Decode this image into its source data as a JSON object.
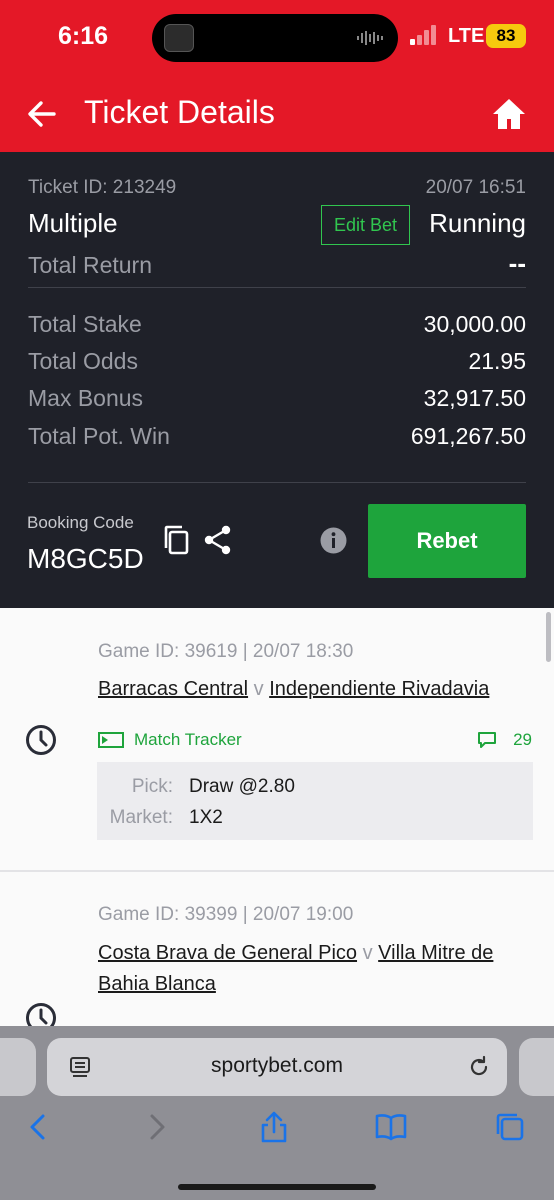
{
  "status_bar": {
    "time": "6:16",
    "network": "LTE",
    "battery": "83"
  },
  "header": {
    "title": "Ticket Details"
  },
  "ticket": {
    "id_label": "Ticket ID: 213249",
    "datetime": "20/07 16:51",
    "type": "Multiple",
    "edit_label": "Edit Bet",
    "status": "Running",
    "total_return_label": "Total Return",
    "total_return_value": "--",
    "rows": [
      {
        "label": "Total Stake",
        "value": "30,000.00"
      },
      {
        "label": "Total Odds",
        "value": "21.95"
      },
      {
        "label": "Max Bonus",
        "value": "32,917.50"
      },
      {
        "label": "Total Pot. Win",
        "value": "691,267.50"
      }
    ],
    "booking_label": "Booking Code",
    "booking_code": "M8GC5D",
    "rebet_label": "Rebet"
  },
  "games": [
    {
      "game_id": "Game ID: 39619 | 20/07 18:30",
      "home": "Barracas Central",
      "vs": "v",
      "away": "Independiente Rivadavia",
      "tracker_label": "Match Tracker",
      "comments": "29",
      "pick_label": "Pick:",
      "pick_value": "Draw @2.80",
      "market_label": "Market:",
      "market_value": "1X2"
    },
    {
      "game_id": "Game ID: 39399 | 20/07 19:00",
      "home": "Costa Brava de General Pico",
      "vs": "v",
      "away": "Villa Mitre de Bahia Blanca"
    }
  ],
  "browser": {
    "url": "sportybet.com"
  },
  "colors": {
    "brand_red": "#e41827",
    "panel_dark": "#1f2129",
    "green": "#1ea43c"
  },
  "icons": [
    "back-arrow-icon",
    "home-icon",
    "copy-icon",
    "share-icon",
    "info-icon",
    "clock-icon",
    "match-tracker-icon",
    "comment-icon",
    "reader-icon",
    "reload-icon",
    "back-icon",
    "forward-icon",
    "share-icon",
    "bookmarks-icon",
    "tabs-icon"
  ]
}
